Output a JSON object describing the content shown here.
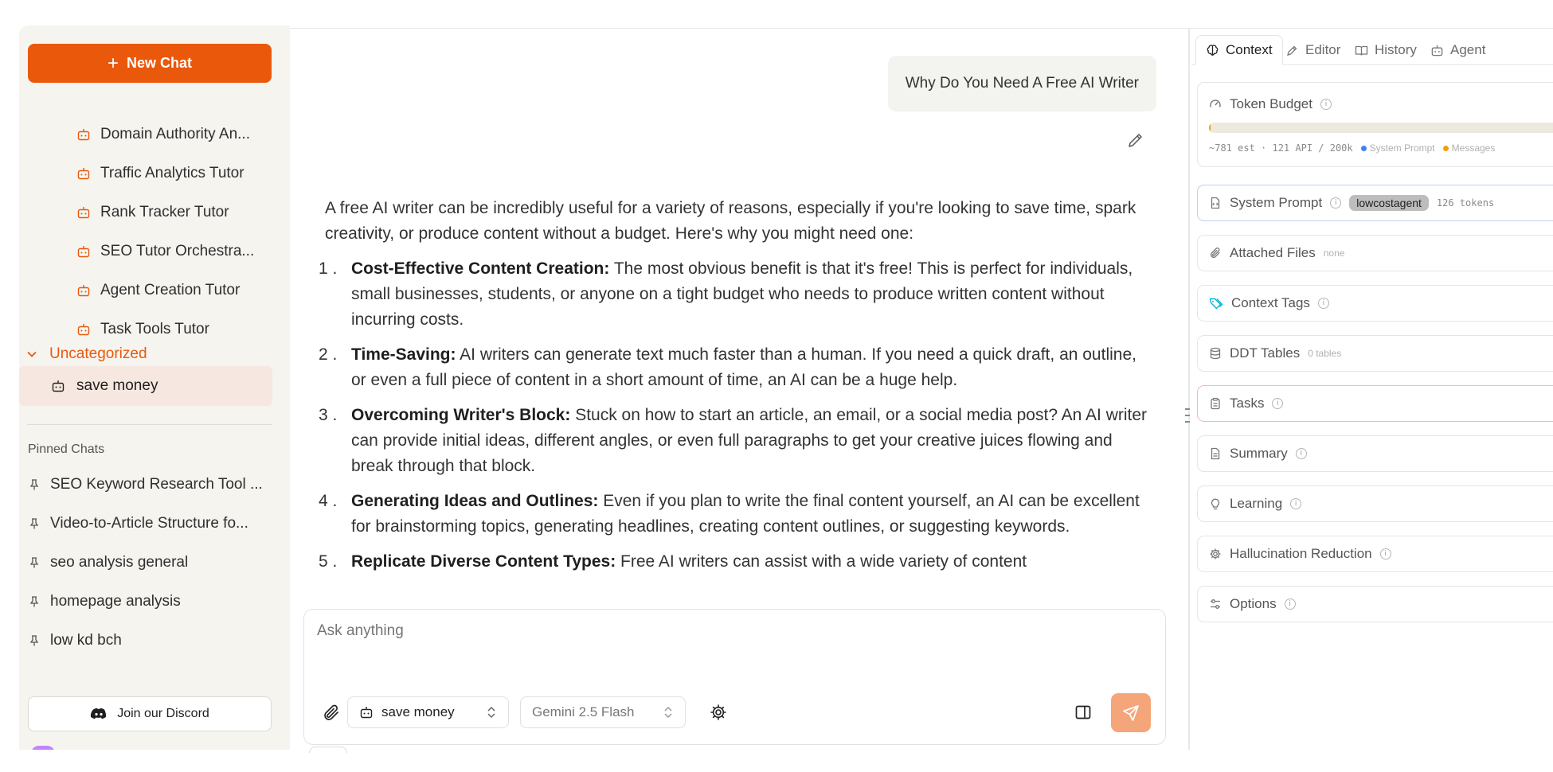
{
  "colors": {
    "accent": "#ea580c",
    "send": "#f5a57a",
    "system_prompt": "#3b82f6",
    "messages": "#f59e0b",
    "tasks_border": "#f3b8b8",
    "system_border": "#bcd2ee",
    "tags_icon": "#06b6d4"
  },
  "sidebar": {
    "new_chat_label": "New Chat",
    "agents": [
      {
        "label": "Domain Authority An...",
        "icon": "bot-icon"
      },
      {
        "label": "Traffic Analytics Tutor",
        "icon": "bot-icon"
      },
      {
        "label": "Rank Tracker Tutor",
        "icon": "bot-icon"
      },
      {
        "label": "SEO Tutor Orchestra...",
        "icon": "bot-icon"
      },
      {
        "label": "Agent Creation Tutor",
        "icon": "bot-icon"
      },
      {
        "label": "Task Tools Tutor",
        "icon": "bot-icon"
      }
    ],
    "section_label": "Uncategorized",
    "active_chat": "save money",
    "pinned_title": "Pinned Chats",
    "pinned": [
      "SEO Keyword Research Tool ...",
      "Video-to-Article Structure fo...",
      "seo analysis general",
      "homepage analysis",
      "low kd bch"
    ],
    "discord_label": "Join our Discord"
  },
  "chat": {
    "user_message": "Why Do You Need A Free AI Writer",
    "intro": "A free AI writer can be incredibly useful for a variety of reasons, especially if you're looking to save time, spark creativity, or produce content without a budget. Here's why you might need one:",
    "points": [
      {
        "num": "1 .",
        "title": "Cost-Effective Content Creation:",
        "text": " The most obvious benefit is that it's free! This is perfect for individuals, small businesses, students, or anyone on a tight budget who needs to produce written content without incurring costs."
      },
      {
        "num": "2 .",
        "title": "Time-Saving:",
        "text": " AI writers can generate text much faster than a human. If you need a quick draft, an outline, or even a full piece of content in a short amount of time, an AI can be a huge help."
      },
      {
        "num": "3 .",
        "title": "Overcoming Writer's Block:",
        "text": " Stuck on how to start an article, an email, or a social media post? An AI writer can provide initial ideas, different angles, or even full paragraphs to get your creative juices flowing and break through that block."
      },
      {
        "num": "4 .",
        "title": "Generating Ideas and Outlines:",
        "text": " Even if you plan to write the final content yourself, an AI can be excellent for brainstorming topics, generating headlines, creating content outlines, or suggesting keywords."
      },
      {
        "num": "5 .",
        "title": "Replicate Diverse Content Types:",
        "text": " Free AI writers can assist with a wide variety of content"
      }
    ]
  },
  "composer": {
    "placeholder": "Ask anything",
    "agent_select": "save money",
    "model_select": "Gemini 2.5 Flash"
  },
  "panel": {
    "tabs": [
      "Context",
      "Editor",
      "History",
      "Agent"
    ],
    "token_budget": {
      "label": "Token Budget",
      "fill_fraction": 0.004,
      "usage": "~781 est · 121 API / 200k",
      "legend_system": "System Prompt",
      "legend_messages": "Messages"
    },
    "system_prompt": {
      "label": "System Prompt",
      "badge": "lowcostagent",
      "tokens": "126 tokens"
    },
    "attached_files": {
      "label": "Attached Files",
      "meta": "none"
    },
    "context_tags": {
      "label": "Context Tags"
    },
    "ddt_tables": {
      "label": "DDT Tables",
      "meta": "0 tables"
    },
    "tasks": {
      "label": "Tasks"
    },
    "summary": {
      "label": "Summary"
    },
    "learning": {
      "label": "Learning"
    },
    "hallucination": {
      "label": "Hallucination Reduction"
    },
    "options": {
      "label": "Options"
    }
  }
}
